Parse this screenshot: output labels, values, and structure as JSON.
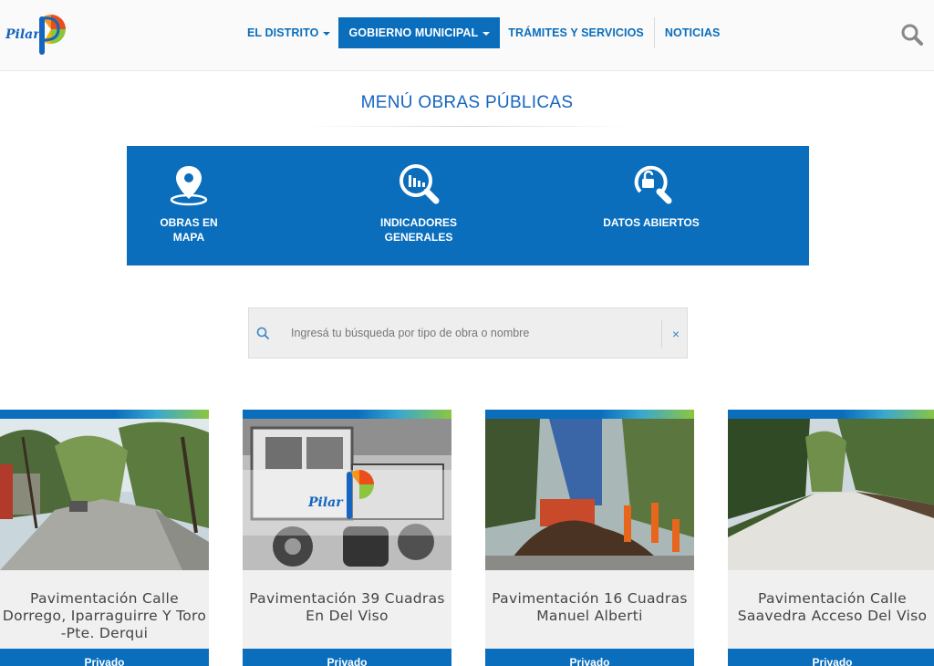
{
  "header": {
    "logo_text": "Pilar",
    "nav": [
      {
        "label": "EL DISTRITO",
        "has_caret": true,
        "active": false
      },
      {
        "label": "GOBIERNO MUNICIPAL",
        "has_caret": true,
        "active": true
      },
      {
        "label": "TRÁMITES Y SERVICIOS",
        "has_caret": false,
        "active": false
      },
      {
        "label": "NOTICIAS",
        "has_caret": false,
        "active": false
      }
    ],
    "search_icon": "search-icon"
  },
  "page_title": "MENÚ OBRAS PÚBLICAS",
  "menu": [
    {
      "line1": "OBRAS EN",
      "line2": "MAPA",
      "icon": "map-pin-icon"
    },
    {
      "line1": "INDICADORES",
      "line2": "GENERALES",
      "icon": "chart-magnifier-icon"
    },
    {
      "line1": "DATOS ABIERTOS",
      "line2": "",
      "icon": "open-lock-magnifier-icon"
    }
  ],
  "search": {
    "placeholder": "Ingresá tu búsqueda por tipo de obra o nombre",
    "value": "",
    "clear_label": "×"
  },
  "cards": [
    {
      "title": "Pavimentación Calle Dorrego, Iparraguirre Y Toro -Pte. Derqui",
      "button": "Privado"
    },
    {
      "title": "Pavimentación 39 Cuadras En Del Viso",
      "button": "Privado"
    },
    {
      "title": "Pavimentación 16 Cuadras Manuel Alberti",
      "button": "Privado"
    },
    {
      "title": "Pavimentación Calle Saavedra Acceso Del Viso",
      "button": "Privado"
    }
  ],
  "colors": {
    "primary": "#0a6ebd",
    "title_blue": "#1565c0",
    "card_bg": "#f0f0f0",
    "accent_green": "#8cc63e"
  }
}
